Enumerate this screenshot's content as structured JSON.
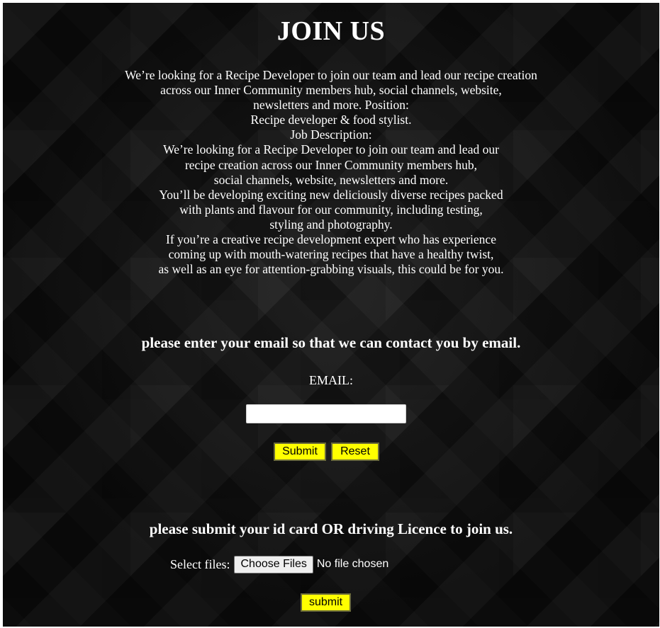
{
  "title": "JOIN US",
  "description_lines": [
    "We’re looking for a Recipe Developer to join our team and lead our recipe creation",
    "across our Inner Community members hub, social channels, website,",
    "newsletters and more. Position:",
    "Recipe developer & food stylist.",
    "Job Description:",
    "We’re looking for a Recipe Developer to join our team and lead our",
    "recipe creation across our Inner Community members hub,",
    "social channels, website, newsletters and more.",
    "You’ll be developing exciting new deliciously diverse recipes packed",
    "with plants and flavour for our community, including testing,",
    "styling and photography.",
    "If you’re a creative recipe development expert who has experience",
    "coming up with mouth-watering recipes that have a healthy twist,",
    "as well as an eye for attention-grabbing visuals, this could be for you."
  ],
  "email_section": {
    "heading": "please enter your email so that we can contact you by email.",
    "label": "EMAIL:",
    "input_value": "",
    "submit_label": "Submit",
    "reset_label": "Reset"
  },
  "id_section": {
    "heading": "please submit your id card OR driving Licence to join us.",
    "select_label": "Select files:",
    "choose_button": "Choose Files",
    "file_status": "No file chosen",
    "submit_label": "submit"
  },
  "colors": {
    "background": "#111111",
    "text": "#ffffff",
    "button_accent": "#ffff00"
  }
}
